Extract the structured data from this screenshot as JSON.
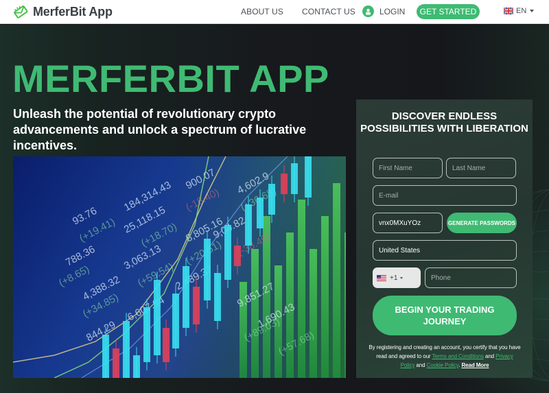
{
  "header": {
    "logo_text": "MerferBit App",
    "nav": {
      "about": "ABOUT US",
      "contact": "CONTACT US",
      "login": "LOGIN",
      "get_started": "GET STARTED"
    },
    "language": {
      "code": "EN",
      "flag": "uk-flag-icon"
    }
  },
  "hero": {
    "title": "MERFERBIT APP",
    "subtitle": "Unleash the potential of revolutionary crypto advancements and unlock a spectrum of lucrative incentives.",
    "image_description": "stock market ticker board with candlestick chart",
    "ticker_values": [
      "184,314.43",
      "25,118.15",
      "(+18.70)",
      "900.07",
      "(-18.40)",
      "8,805.16",
      "(+20.51)",
      "3,063.13",
      "(+59.54)",
      "2,489.37",
      "4,602.9",
      "(+36.68)",
      "9,04.82",
      "(-38.49)",
      "6,607.94",
      "4,388.32",
      "(+34.85)",
      "844.29",
      "9,851.27",
      "(+89.03)",
      "1,690.43",
      "(+57.68)",
      "93.76",
      "(+19.41)",
      "788.36",
      "(+8.65)"
    ]
  },
  "form": {
    "title": "DISCOVER ENDLESS POSSIBILITIES WITH LIBERATION",
    "first_name_placeholder": "First Name",
    "last_name_placeholder": "Last Name",
    "email_placeholder": "E-mail",
    "password_value": "vnx0MXuYOz",
    "generate_label": "GENERATE PASSWORDS",
    "country_value": "United States",
    "phone_code": "+1",
    "phone_placeholder": "Phone",
    "submit_label": "BEGIN YOUR TRADING JOURNEY",
    "legal": {
      "text_1": "By registering and creating an account, you certify that you have read and agreed to our ",
      "terms": "Terms and Conditions",
      "text_2": " and ",
      "privacy": "Privacy Policy",
      "text_3": " and ",
      "cookie": "Cookie Policy",
      "text_4": ". ",
      "read_more": "Read More"
    }
  },
  "colors": {
    "accent": "#3fba73",
    "panel": "#2a3a35",
    "background": "#15171b"
  }
}
